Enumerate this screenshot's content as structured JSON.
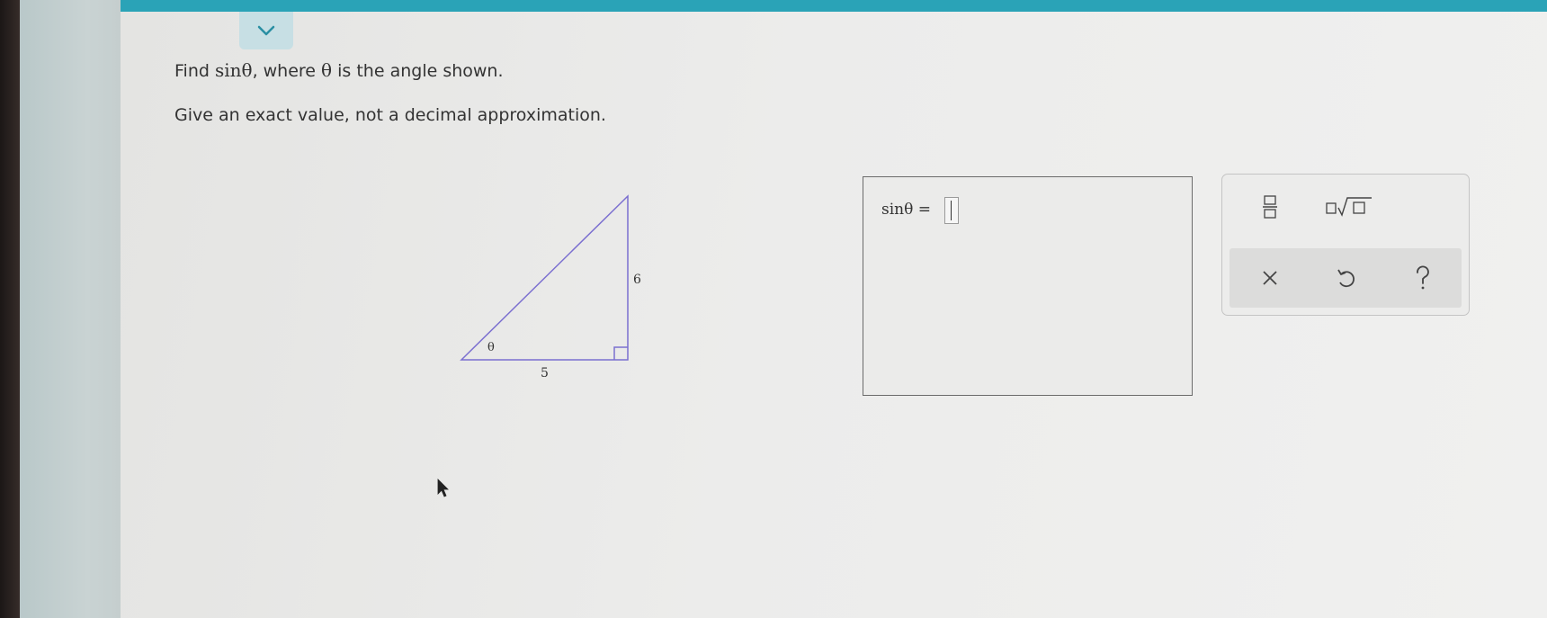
{
  "question": {
    "find_prefix": "Find ",
    "find_math": "sinθ",
    "find_mid": ", where ",
    "theta": "θ",
    "find_suffix": " is the angle shown.",
    "instruction": "Give an exact value, not a decimal approximation."
  },
  "triangle": {
    "vertical_side_label": "6",
    "horizontal_side_label": "5",
    "angle_label": "θ"
  },
  "answer": {
    "label": "sinθ ="
  },
  "toolbar": {
    "fraction_icon": "fraction-icon",
    "sqrt_icon": "sqrt-icon",
    "clear_icon": "x-icon",
    "undo_icon": "undo-icon",
    "help_icon": "question-icon"
  },
  "colors": {
    "topbar": "#2aa3b7",
    "triangle_stroke": "#7b6fd0"
  }
}
